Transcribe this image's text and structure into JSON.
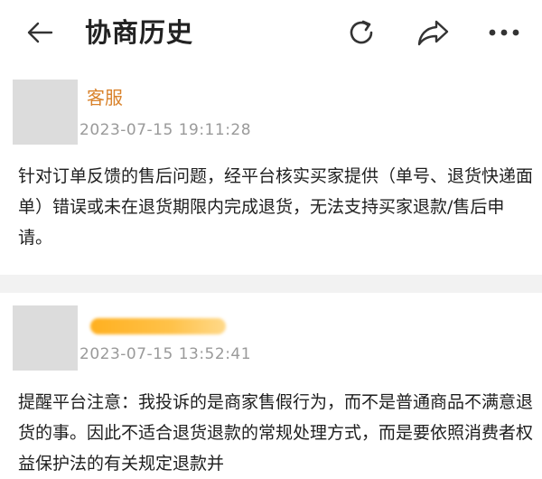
{
  "header": {
    "title": "协商历史",
    "back_icon": "back-arrow-icon",
    "refresh_icon": "refresh-icon",
    "share_icon": "share-icon",
    "more_icon": "more-dots-icon"
  },
  "records": [
    {
      "author": "客服",
      "timestamp": "2023-07-15 19:11:28",
      "message": "针对订单反馈的售后问题，经平台核实买家提供（单号、退货快递面单）错误或未在退货期限内完成退货，无法支持买家退款/售后申请。"
    },
    {
      "author_redacted": true,
      "timestamp": "2023-07-15 13:52:41",
      "message": "提醒平台注意：我投诉的是商家售假行为，而不是普通商品不满意退货的事。因此不适合退货退款的常规处理方式，而是要依照消费者权益保护法的有关规定退款并"
    }
  ],
  "colors": {
    "accent": "#d9822b",
    "redaction": "#ffb020",
    "timestamp": "#9a9a9a",
    "background": "#f2f2f2"
  }
}
